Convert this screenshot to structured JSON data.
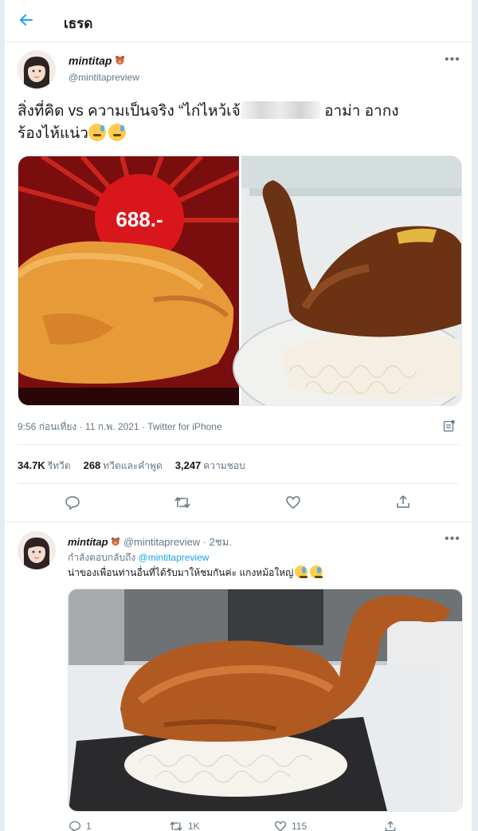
{
  "header": {
    "title": "เธรด",
    "back_icon": "back-arrow-icon",
    "accent": "#1da1f2"
  },
  "tweet": {
    "display_name": "mintitap",
    "handle": "@mintitapreview",
    "text_line1_before": "สิ่งที่คิด vs ความเป็นจริง “ไก่ไหว้เจ้",
    "text_line1_after": "อาม่า อากง",
    "text_line2": "ร้องไห้แน่ว",
    "price_tag": "688.-",
    "timestamp": "9:56 ก่อนเที่ยง · 11 ก.พ. 2021 · Twitter for iPhone",
    "stats": {
      "retweets_count": "34.7K",
      "retweets_label": "รีทวีต",
      "quotes_count": "268",
      "quotes_label": "ทวีตและคำพูด",
      "likes_count": "3,247",
      "likes_label": "ความชอบ"
    }
  },
  "reply": {
    "display_name": "mintitap",
    "handle": "@mintitapreview",
    "time": "· 2ชม.",
    "replying_label": "กำลังตอบกลับถึง",
    "replying_handle": "@mintitapreview",
    "text": "น่าของเพื่อนท่านอื่นที่ได้รับมาให้ชมกันค่ะ แกงหม้อใหญ่",
    "actions": {
      "replies": "1",
      "retweets": "1K",
      "likes": "115"
    }
  }
}
